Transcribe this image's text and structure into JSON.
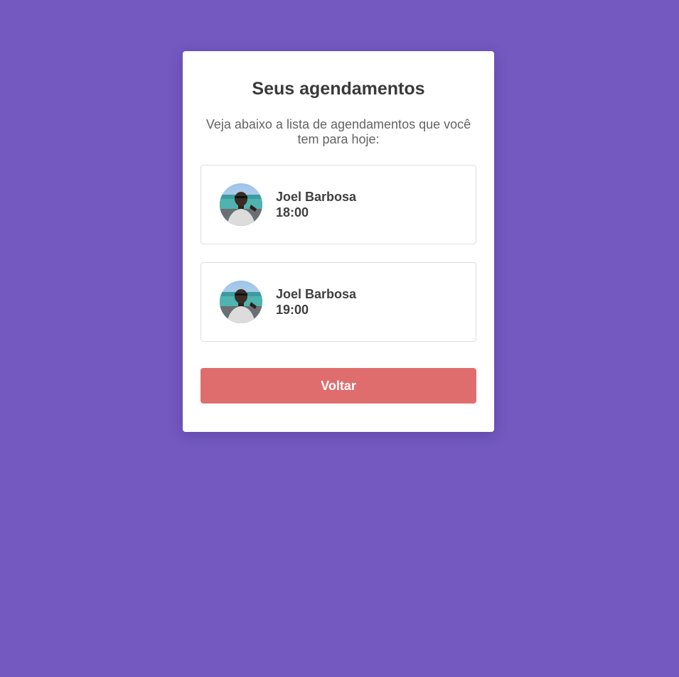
{
  "page": {
    "title": "Seus agendamentos",
    "subtitle": "Veja abaixo a lista de agendamentos que você tem para hoje:"
  },
  "appointments": [
    {
      "name": "Joel Barbosa",
      "time": "18:00",
      "avatar": "person-photo"
    },
    {
      "name": "Joel Barbosa",
      "time": "19:00",
      "avatar": "person-photo"
    }
  ],
  "actions": {
    "back_label": "Voltar"
  },
  "colors": {
    "background": "#7359c0",
    "card": "#ffffff",
    "button": "#e06d6d"
  }
}
